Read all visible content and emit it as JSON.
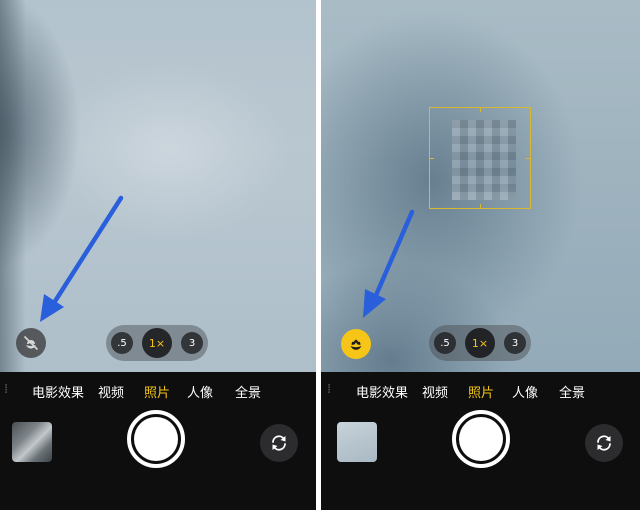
{
  "left_screen": {
    "zoom": {
      "half_label": ".5",
      "one_label": "1×",
      "three_label": "3"
    },
    "modes": [
      {
        "label": "电影效果"
      },
      {
        "label": "视频"
      },
      {
        "label": "照片"
      },
      {
        "label": "人像"
      },
      {
        "label": "全景"
      }
    ],
    "macro_icon": "macro-off-icon",
    "active_mode": "照片"
  },
  "right_screen": {
    "zoom": {
      "half_label": ".5",
      "one_label": "1×",
      "three_label": "3"
    },
    "modes": [
      {
        "label": "电影效果"
      },
      {
        "label": "视频"
      },
      {
        "label": "照片"
      },
      {
        "label": "人像"
      },
      {
        "label": "全景"
      }
    ],
    "macro_icon": "macro-on-icon",
    "active_mode": "照片"
  },
  "colors": {
    "accent": "#f5c517",
    "arrow": "#2a5fdc",
    "focus_box": "#d8b830"
  }
}
